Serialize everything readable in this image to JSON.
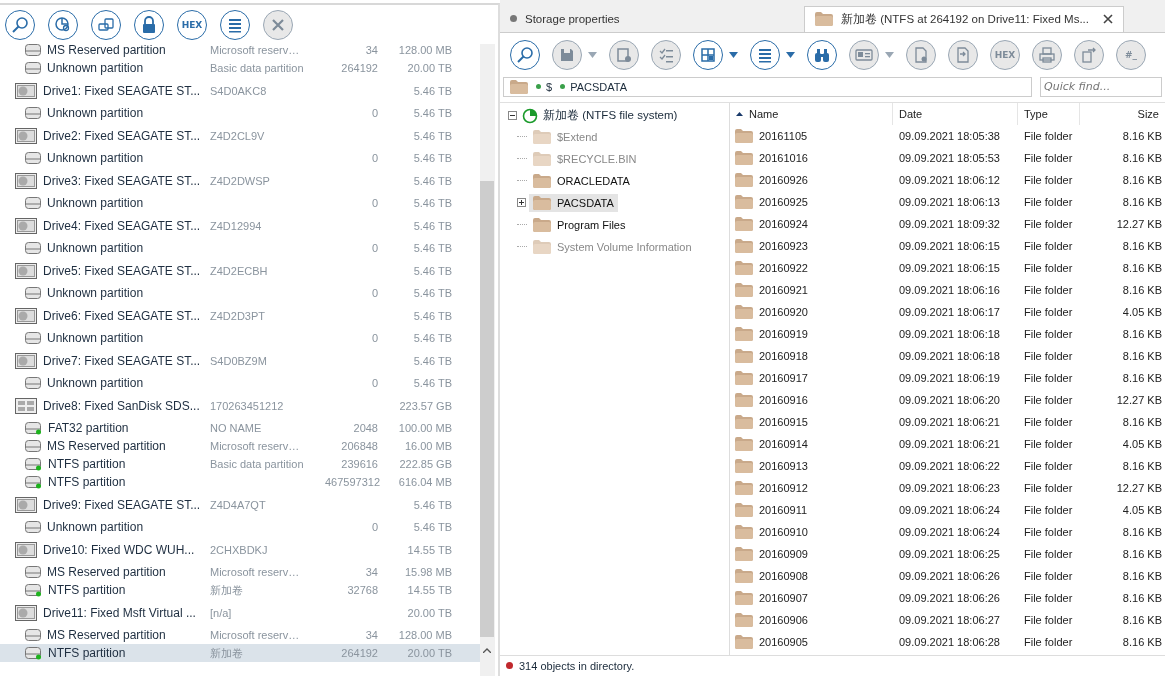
{
  "left_toolbar": [
    {
      "kind": "scan",
      "disabled": false
    },
    {
      "kind": "partition-scan",
      "disabled": false
    },
    {
      "kind": "image",
      "disabled": false
    },
    {
      "kind": "lock",
      "disabled": false
    },
    {
      "kind": "hex",
      "label": "HEX",
      "disabled": false
    },
    {
      "kind": "list",
      "disabled": false
    },
    {
      "kind": "close",
      "disabled": true
    }
  ],
  "devices": [
    {
      "kind": "partition",
      "name": "MS Reserved partition",
      "description": "Microsoft reserv…",
      "start": "34",
      "size": "128.00 MB",
      "selected": false
    },
    {
      "kind": "partition",
      "name": "Unknown partition",
      "description": "Basic data partition",
      "start": "264192",
      "size": "20.00 TB",
      "selected": false
    },
    {
      "kind": "hdd",
      "name": "Drive1: Fixed SEAGATE ST...",
      "description": "S4D0AKC8",
      "size": "5.46 TB",
      "selected": false
    },
    {
      "kind": "partition",
      "name": "Unknown partition",
      "start": "0",
      "size": "5.46 TB",
      "selected": false
    },
    {
      "kind": "hdd",
      "name": "Drive2: Fixed SEAGATE ST...",
      "description": "Z4D2CL9V",
      "size": "5.46 TB",
      "selected": false
    },
    {
      "kind": "partition",
      "name": "Unknown partition",
      "start": "0",
      "size": "5.46 TB",
      "selected": false
    },
    {
      "kind": "hdd",
      "name": "Drive3: Fixed SEAGATE ST...",
      "description": "Z4D2DWSP",
      "size": "5.46 TB",
      "selected": false
    },
    {
      "kind": "partition",
      "name": "Unknown partition",
      "start": "0",
      "size": "5.46 TB",
      "selected": false
    },
    {
      "kind": "hdd",
      "name": "Drive4: Fixed SEAGATE ST...",
      "description": "Z4D12994",
      "size": "5.46 TB",
      "selected": false
    },
    {
      "kind": "partition",
      "name": "Unknown partition",
      "start": "0",
      "size": "5.46 TB",
      "selected": false
    },
    {
      "kind": "hdd",
      "name": "Drive5: Fixed SEAGATE ST...",
      "description": "Z4D2ECBH",
      "size": "5.46 TB",
      "selected": false
    },
    {
      "kind": "partition",
      "name": "Unknown partition",
      "start": "0",
      "size": "5.46 TB",
      "selected": false
    },
    {
      "kind": "hdd",
      "name": "Drive6: Fixed SEAGATE ST...",
      "description": "Z4D2D3PT",
      "size": "5.46 TB",
      "selected": false
    },
    {
      "kind": "partition",
      "name": "Unknown partition",
      "start": "0",
      "size": "5.46 TB",
      "selected": false
    },
    {
      "kind": "hdd",
      "name": "Drive7: Fixed SEAGATE ST...",
      "description": "S4D0BZ9M",
      "size": "5.46 TB",
      "selected": false
    },
    {
      "kind": "partition",
      "name": "Unknown partition",
      "start": "0",
      "size": "5.46 TB",
      "selected": false
    },
    {
      "kind": "ssd",
      "name": "Drive8: Fixed SanDisk SDS...",
      "description": "170263451212",
      "size": "223.57 GB",
      "selected": false
    },
    {
      "kind": "volume",
      "name": "FAT32 partition",
      "description": "NO NAME",
      "start": "2048",
      "size": "100.00 MB",
      "selected": false
    },
    {
      "kind": "partition",
      "name": "MS Reserved partition",
      "description": "Microsoft reserv…",
      "start": "206848",
      "size": "16.00 MB",
      "selected": false
    },
    {
      "kind": "volume",
      "name": "NTFS partition",
      "description": "Basic data partition",
      "start": "239616",
      "size": "222.85 GB",
      "selected": false
    },
    {
      "kind": "volume",
      "name": "NTFS partition",
      "start": "467597312",
      "size": "616.04 MB",
      "selected": false
    },
    {
      "kind": "hdd",
      "name": "Drive9: Fixed SEAGATE ST...",
      "description": "Z4D4A7QT",
      "size": "5.46 TB",
      "selected": false
    },
    {
      "kind": "partition",
      "name": "Unknown partition",
      "start": "0",
      "size": "5.46 TB",
      "selected": false
    },
    {
      "kind": "hdd",
      "name": "Drive10: Fixed WDC  WUH...",
      "description": "2CHXBDKJ",
      "size": "14.55 TB",
      "selected": false
    },
    {
      "kind": "partition",
      "name": "MS Reserved partition",
      "description": "Microsoft reserv…",
      "start": "34",
      "size": "15.98 MB",
      "selected": false
    },
    {
      "kind": "volume",
      "name": "NTFS partition",
      "description": "新加卷",
      "start": "32768",
      "size": "14.55 TB",
      "selected": false
    },
    {
      "kind": "hdd",
      "name": "Drive11: Fixed Msft Virtual ...",
      "description": "[n/a]",
      "size": "20.00 TB",
      "selected": false
    },
    {
      "kind": "partition",
      "name": "MS Reserved partition",
      "description": "Microsoft reserv…",
      "start": "34",
      "size": "128.00 MB",
      "selected": false
    },
    {
      "kind": "volume",
      "name": "NTFS partition",
      "description": "新加卷",
      "start": "264192",
      "size": "20.00 TB",
      "selected": true
    }
  ],
  "tabs": [
    {
      "label": "Storage properties",
      "selected": false
    },
    {
      "label": "新加卷 (NTFS at 264192 on Drive11: Fixed Ms...",
      "selected": true
    }
  ],
  "toolbar": [
    {
      "kind": "scan",
      "disabled": false
    },
    {
      "kind": "save",
      "disabled": true,
      "dropdown": true
    },
    {
      "kind": "properties",
      "disabled": true
    },
    {
      "kind": "checklist",
      "disabled": true
    },
    {
      "kind": "grid",
      "disabled": false,
      "dropdown": true
    },
    {
      "kind": "list",
      "disabled": false,
      "dropdown": true
    },
    {
      "kind": "find",
      "disabled": false
    },
    {
      "kind": "preview",
      "disabled": true,
      "dropdown": true
    },
    {
      "kind": "file-settings",
      "disabled": true
    },
    {
      "kind": "file-export",
      "disabled": true
    },
    {
      "kind": "hex",
      "label": "HEX",
      "disabled": true
    },
    {
      "kind": "print",
      "disabled": true
    },
    {
      "kind": "export",
      "disabled": true
    },
    {
      "kind": "hash",
      "label": "#_",
      "disabled": true
    }
  ],
  "path": [
    "$",
    "PACSDATA"
  ],
  "quick_find": {
    "placeholder": "Quick find..."
  },
  "tree": {
    "label": "新加卷 (NTFS file system)",
    "expanded": true,
    "children": [
      {
        "label": "$Extend",
        "dimmed": true,
        "expandable": false,
        "selected": false
      },
      {
        "label": "$RECYCLE.BIN",
        "dimmed": true,
        "expandable": false,
        "selected": false
      },
      {
        "label": "ORACLEDATA",
        "dimmed": false,
        "expandable": false,
        "selected": false
      },
      {
        "label": "PACSDATA",
        "dimmed": false,
        "expandable": true,
        "selected": true
      },
      {
        "label": "Program Files",
        "dimmed": false,
        "expandable": false,
        "selected": false
      },
      {
        "label": "System Volume Information",
        "dimmed": true,
        "expandable": false,
        "selected": false
      }
    ]
  },
  "table": {
    "columns": [
      {
        "label": "Name",
        "sorted": true
      },
      {
        "label": "Date",
        "sorted": false
      },
      {
        "label": "Type",
        "sorted": false
      },
      {
        "label": "Size",
        "sorted": false
      }
    ],
    "rows": [
      [
        "20161105",
        "09.09.2021 18:05:38",
        "File folder",
        "8.16 KB"
      ],
      [
        "20161016",
        "09.09.2021 18:05:53",
        "File folder",
        "8.16 KB"
      ],
      [
        "20160926",
        "09.09.2021 18:06:12",
        "File folder",
        "8.16 KB"
      ],
      [
        "20160925",
        "09.09.2021 18:06:13",
        "File folder",
        "8.16 KB"
      ],
      [
        "20160924",
        "09.09.2021 18:09:32",
        "File folder",
        "12.27 KB"
      ],
      [
        "20160923",
        "09.09.2021 18:06:15",
        "File folder",
        "8.16 KB"
      ],
      [
        "20160922",
        "09.09.2021 18:06:15",
        "File folder",
        "8.16 KB"
      ],
      [
        "20160921",
        "09.09.2021 18:06:16",
        "File folder",
        "8.16 KB"
      ],
      [
        "20160920",
        "09.09.2021 18:06:17",
        "File folder",
        "4.05 KB"
      ],
      [
        "20160919",
        "09.09.2021 18:06:18",
        "File folder",
        "8.16 KB"
      ],
      [
        "20160918",
        "09.09.2021 18:06:18",
        "File folder",
        "8.16 KB"
      ],
      [
        "20160917",
        "09.09.2021 18:06:19",
        "File folder",
        "8.16 KB"
      ],
      [
        "20160916",
        "09.09.2021 18:06:20",
        "File folder",
        "12.27 KB"
      ],
      [
        "20160915",
        "09.09.2021 18:06:21",
        "File folder",
        "8.16 KB"
      ],
      [
        "20160914",
        "09.09.2021 18:06:21",
        "File folder",
        "4.05 KB"
      ],
      [
        "20160913",
        "09.09.2021 18:06:22",
        "File folder",
        "8.16 KB"
      ],
      [
        "20160912",
        "09.09.2021 18:06:23",
        "File folder",
        "12.27 KB"
      ],
      [
        "20160911",
        "09.09.2021 18:06:24",
        "File folder",
        "4.05 KB"
      ],
      [
        "20160910",
        "09.09.2021 18:06:24",
        "File folder",
        "8.16 KB"
      ],
      [
        "20160909",
        "09.09.2021 18:06:25",
        "File folder",
        "8.16 KB"
      ],
      [
        "20160908",
        "09.09.2021 18:06:26",
        "File folder",
        "8.16 KB"
      ],
      [
        "20160907",
        "09.09.2021 18:06:26",
        "File folder",
        "8.16 KB"
      ],
      [
        "20160906",
        "09.09.2021 18:06:27",
        "File folder",
        "8.16 KB"
      ],
      [
        "20160905",
        "09.09.2021 18:06:28",
        "File folder",
        "8.16 KB"
      ]
    ]
  },
  "status_bar": {
    "text": "314 objects in directory."
  }
}
